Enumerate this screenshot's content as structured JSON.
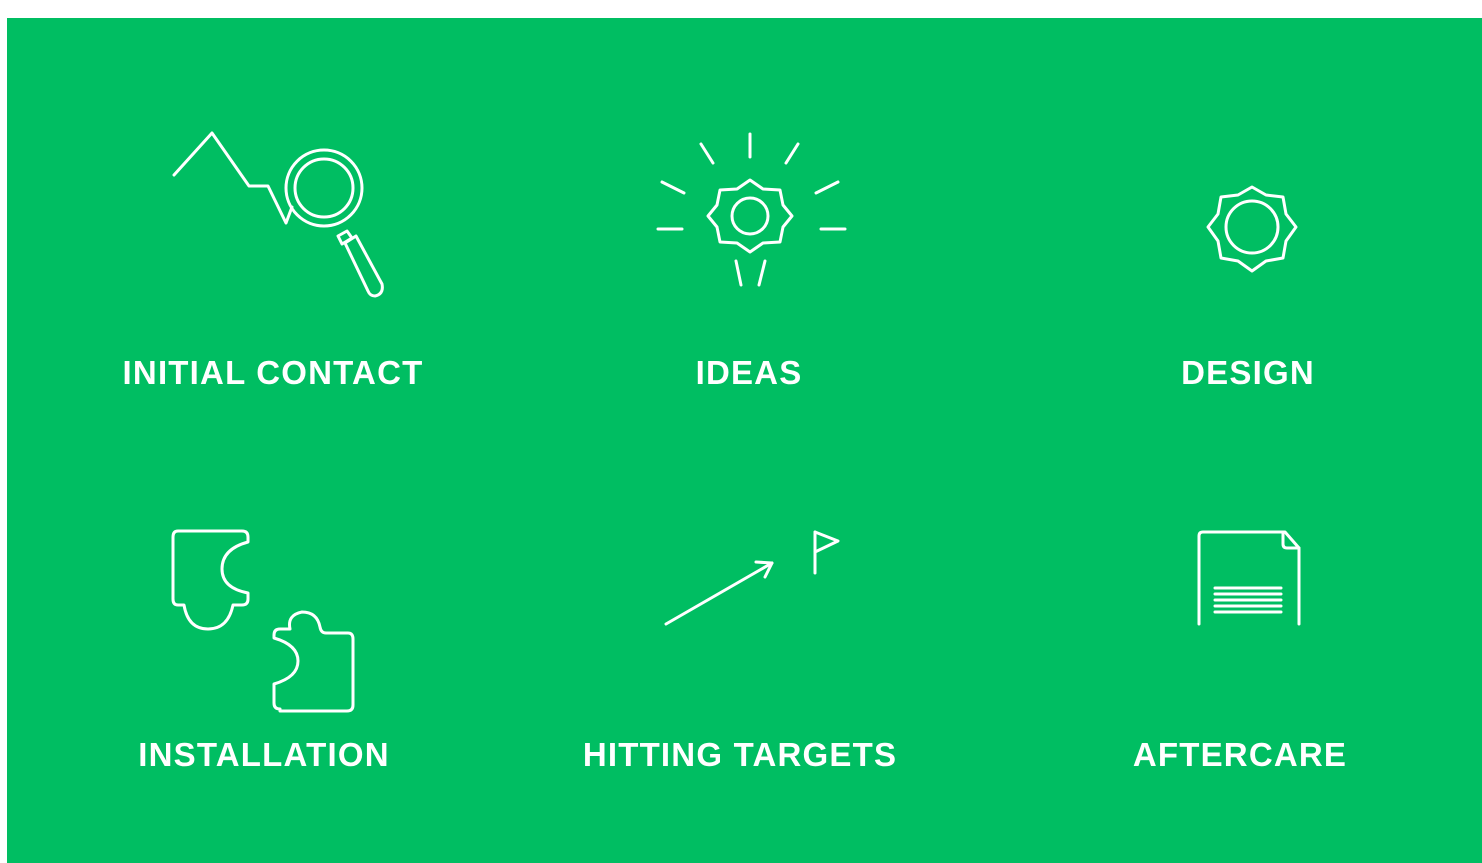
{
  "colors": {
    "background": "#00be62",
    "foreground": "#ffffff",
    "page": "#ffffff"
  },
  "steps": [
    {
      "label": "INITIAL CONTACT",
      "icon": "magnifier-trend-icon"
    },
    {
      "label": "IDEAS",
      "icon": "lightbulb-gear-icon"
    },
    {
      "label": "DESIGN",
      "icon": "gear-icon"
    },
    {
      "label": "INSTALLATION",
      "icon": "puzzle-pieces-icon"
    },
    {
      "label": "HITTING TARGETS",
      "icon": "arrow-flag-icon"
    },
    {
      "label": "AFTERCARE",
      "icon": "document-icon"
    }
  ]
}
